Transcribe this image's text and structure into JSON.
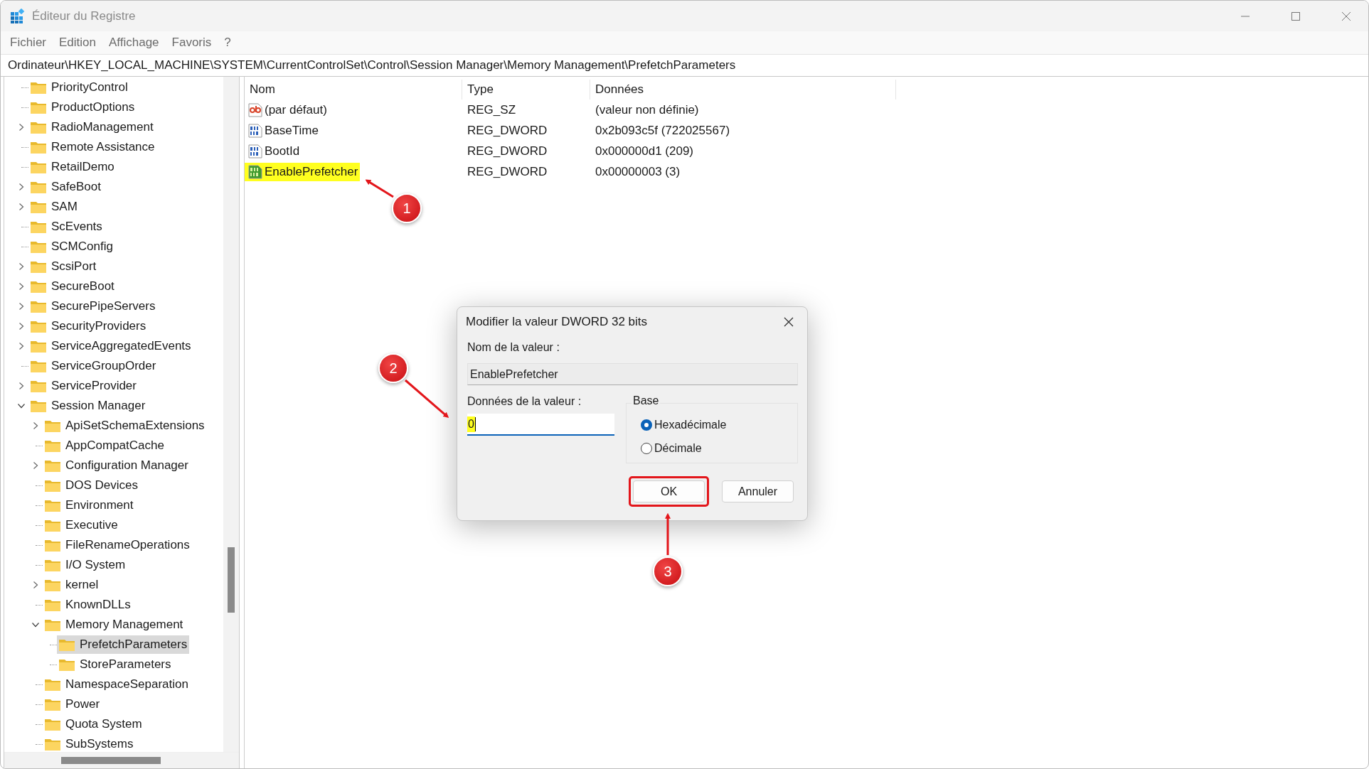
{
  "window": {
    "title": "Éditeur du Registre"
  },
  "menu": [
    "Fichier",
    "Edition",
    "Affichage",
    "Favoris",
    "?"
  ],
  "address": "Ordinateur\\HKEY_LOCAL_MACHINE\\SYSTEM\\CurrentControlSet\\Control\\Session Manager\\Memory Management\\PrefetchParameters",
  "tree": [
    {
      "label": "PriorityControl",
      "has_subkeys": false,
      "expanded": false,
      "selected": false
    },
    {
      "label": "ProductOptions",
      "has_subkeys": false,
      "expanded": false,
      "selected": false
    },
    {
      "label": "RadioManagement",
      "has_subkeys": true,
      "expanded": false,
      "selected": false
    },
    {
      "label": "Remote Assistance",
      "has_subkeys": false,
      "expanded": false,
      "selected": false
    },
    {
      "label": "RetailDemo",
      "has_subkeys": false,
      "expanded": false,
      "selected": false
    },
    {
      "label": "SafeBoot",
      "has_subkeys": true,
      "expanded": false,
      "selected": false
    },
    {
      "label": "SAM",
      "has_subkeys": true,
      "expanded": false,
      "selected": false
    },
    {
      "label": "ScEvents",
      "has_subkeys": false,
      "expanded": false,
      "selected": false
    },
    {
      "label": "SCMConfig",
      "has_subkeys": false,
      "expanded": false,
      "selected": false
    },
    {
      "label": "ScsiPort",
      "has_subkeys": true,
      "expanded": false,
      "selected": false
    },
    {
      "label": "SecureBoot",
      "has_subkeys": true,
      "expanded": false,
      "selected": false
    },
    {
      "label": "SecurePipeServers",
      "has_subkeys": true,
      "expanded": false,
      "selected": false
    },
    {
      "label": "SecurityProviders",
      "has_subkeys": true,
      "expanded": false,
      "selected": false
    },
    {
      "label": "ServiceAggregatedEvents",
      "has_subkeys": true,
      "expanded": false,
      "selected": false
    },
    {
      "label": "ServiceGroupOrder",
      "has_subkeys": false,
      "expanded": false,
      "selected": false
    },
    {
      "label": "ServiceProvider",
      "has_subkeys": true,
      "expanded": false,
      "selected": false
    },
    {
      "label": "Session Manager",
      "has_subkeys": true,
      "expanded": true,
      "selected": false,
      "children": [
        {
          "label": "ApiSetSchemaExtensions",
          "has_subkeys": true,
          "expanded": false,
          "selected": false
        },
        {
          "label": "AppCompatCache",
          "has_subkeys": false,
          "expanded": false,
          "selected": false
        },
        {
          "label": "Configuration Manager",
          "has_subkeys": true,
          "expanded": false,
          "selected": false
        },
        {
          "label": "DOS Devices",
          "has_subkeys": false,
          "expanded": false,
          "selected": false
        },
        {
          "label": "Environment",
          "has_subkeys": false,
          "expanded": false,
          "selected": false
        },
        {
          "label": "Executive",
          "has_subkeys": false,
          "expanded": false,
          "selected": false
        },
        {
          "label": "FileRenameOperations",
          "has_subkeys": false,
          "expanded": false,
          "selected": false
        },
        {
          "label": "I/O System",
          "has_subkeys": false,
          "expanded": false,
          "selected": false
        },
        {
          "label": "kernel",
          "has_subkeys": true,
          "expanded": false,
          "selected": false
        },
        {
          "label": "KnownDLLs",
          "has_subkeys": false,
          "expanded": false,
          "selected": false
        },
        {
          "label": "Memory Management",
          "has_subkeys": true,
          "expanded": true,
          "selected": false,
          "children": [
            {
              "label": "PrefetchParameters",
              "has_subkeys": false,
              "expanded": false,
              "selected": true
            },
            {
              "label": "StoreParameters",
              "has_subkeys": false,
              "expanded": false,
              "selected": false
            }
          ]
        },
        {
          "label": "NamespaceSeparation",
          "has_subkeys": false,
          "expanded": false,
          "selected": false
        },
        {
          "label": "Power",
          "has_subkeys": false,
          "expanded": false,
          "selected": false
        },
        {
          "label": "Quota System",
          "has_subkeys": false,
          "expanded": false,
          "selected": false
        },
        {
          "label": "SubSystems",
          "has_subkeys": false,
          "expanded": false,
          "selected": false
        }
      ]
    }
  ],
  "values": {
    "columns": [
      "Nom",
      "Type",
      "Données"
    ],
    "rows": [
      {
        "kind": "string",
        "name": "(par défaut)",
        "type": "REG_SZ",
        "data": "(valeur non définie)",
        "highlighted": false
      },
      {
        "kind": "binary",
        "name": "BaseTime",
        "type": "REG_DWORD",
        "data": "0x2b093c5f (722025567)",
        "highlighted": false
      },
      {
        "kind": "binary",
        "name": "BootId",
        "type": "REG_DWORD",
        "data": "0x000000d1 (209)",
        "highlighted": false
      },
      {
        "kind": "binary",
        "name": "EnablePrefetcher",
        "type": "REG_DWORD",
        "data": "0x00000003 (3)",
        "highlighted": true
      }
    ]
  },
  "dialog": {
    "title": "Modifier la valeur DWORD 32 bits",
    "name_label": "Nom de la valeur :",
    "name_value": "EnablePrefetcher",
    "data_label": "Données de la valeur :",
    "data_value": "0",
    "data_highlighted": true,
    "base_label": "Base",
    "radios": [
      {
        "label": "Hexadécimale",
        "selected": true
      },
      {
        "label": "Décimale",
        "selected": false
      }
    ],
    "buttons": [
      {
        "label": "OK",
        "outlined": true
      },
      {
        "label": "Annuler",
        "outlined": false
      }
    ]
  },
  "annotations": [
    "1",
    "2",
    "3"
  ]
}
